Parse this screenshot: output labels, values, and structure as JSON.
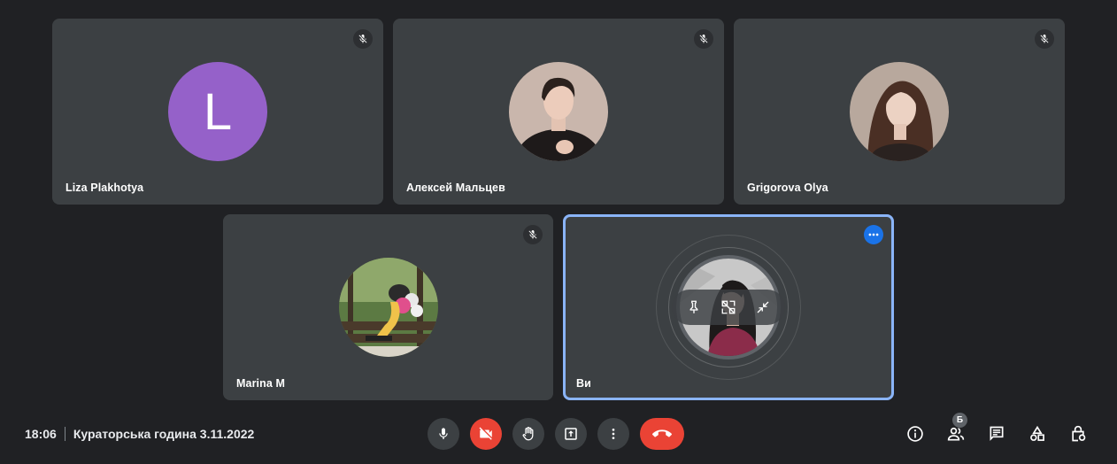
{
  "participants": [
    {
      "name": "Liza Plakhotya",
      "avatar_letter": "L",
      "avatar_color": "#9561c9",
      "muted": true,
      "avatar_type": "letter"
    },
    {
      "name": "Алексей Мальцев",
      "muted": true,
      "avatar_type": "photo"
    },
    {
      "name": "Grigorova Olya",
      "muted": true,
      "avatar_type": "photo"
    },
    {
      "name": "Marina M",
      "muted": true,
      "avatar_type": "photo"
    },
    {
      "name": "Ви",
      "muted": false,
      "avatar_type": "photo",
      "active": true
    }
  ],
  "bottombar": {
    "time": "18:06",
    "meeting_title": "Кураторська година 3.11.2022",
    "people_count": "Б"
  },
  "icons": {
    "muted": "mic-off-icon",
    "more": "more-horiz-icon",
    "pin": "pin-icon",
    "remove": "remove-icon",
    "minimize": "minimize-icon",
    "mic": "mic-icon",
    "camera_off": "videocam-off-icon",
    "raise_hand": "hand-icon",
    "present": "present-icon",
    "more_options": "more-vert-icon",
    "leave": "call-end-icon",
    "info": "info-icon",
    "people": "people-icon",
    "chat": "chat-icon",
    "activities": "activities-icon",
    "host_controls": "lock-person-icon"
  },
  "colors": {
    "background": "#202124",
    "tile": "#3c4043",
    "active_outline": "#8ab4f8",
    "danger": "#ea4335",
    "accent": "#1a73e8"
  }
}
